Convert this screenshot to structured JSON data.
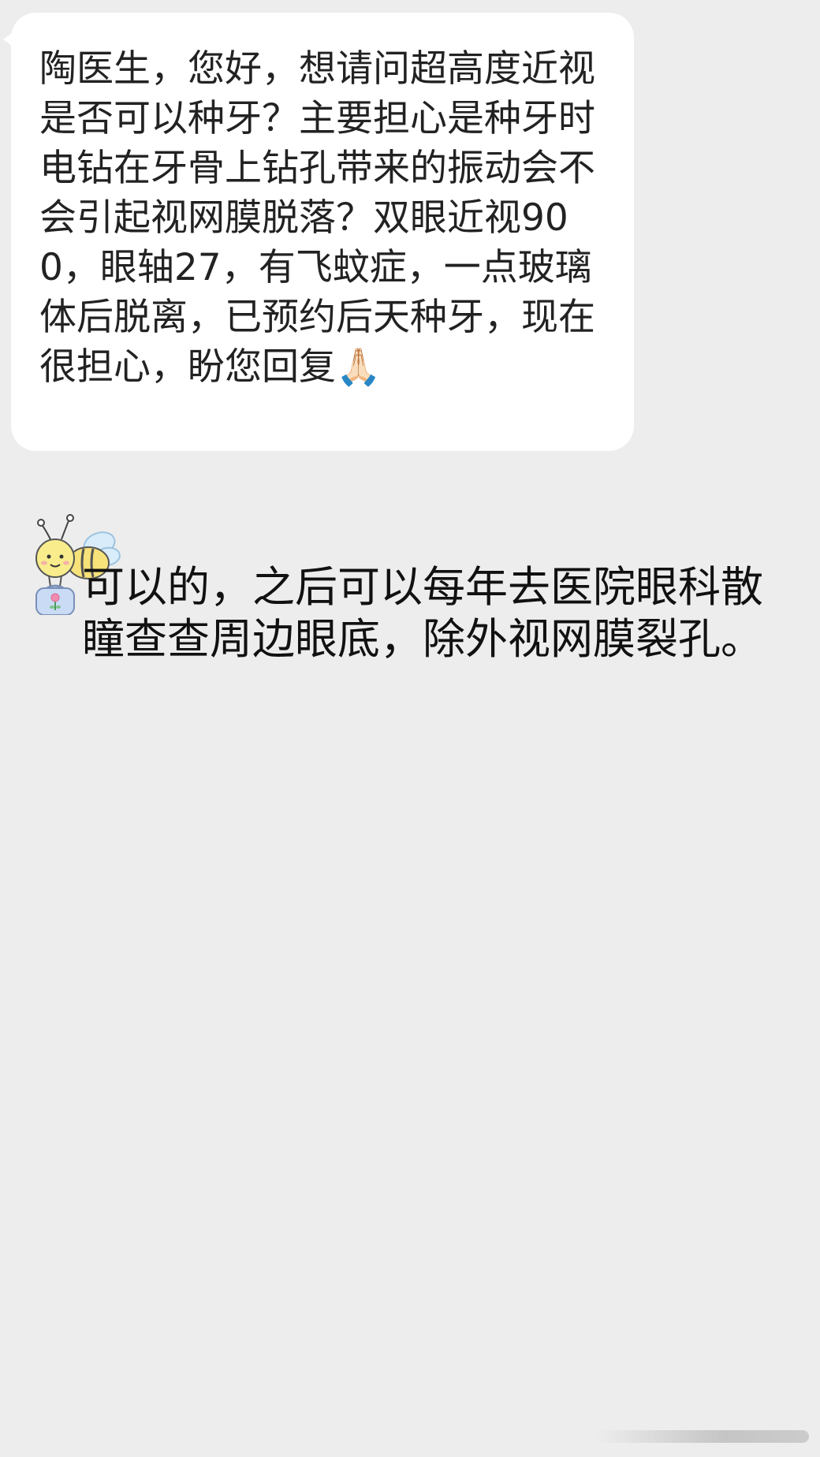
{
  "conversation": {
    "incoming_message": {
      "text": "陶医生，您好，想请问超高度近视是否可以种牙？主要担心是种牙时电钻在牙骨上钻孔带来的振动会不会引起视网膜脱落？双眼近视900，眼轴27，有飞蚊症，一点玻璃体后脱离，已预约后天种牙，现在很担心，盼您回复",
      "trailing_emoji": "🙏🏻"
    },
    "reply_message": {
      "text": "可以的，之后可以每年去医院眼科散瞳查查周边眼底，除外视网膜裂孔。",
      "sticker_icon": "bee-with-flower-bag-icon"
    }
  },
  "colors": {
    "background": "#ededed",
    "bubble": "#ffffff",
    "text": "#222222"
  }
}
